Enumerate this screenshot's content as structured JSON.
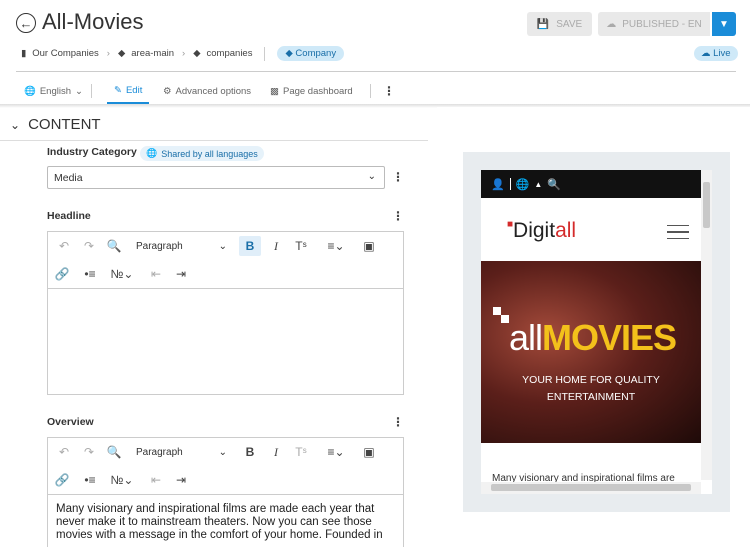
{
  "header": {
    "title": "All-Movies",
    "save_label": "SAVE",
    "publish_label": "PUBLISHED - EN",
    "breadcrumb": [
      "Our Companies",
      "area-main",
      "companies"
    ],
    "company_pill": "Company",
    "live_badge": "Live"
  },
  "tabs": {
    "language": "English",
    "edit": "Edit",
    "advanced": "Advanced options",
    "dashboard": "Page dashboard"
  },
  "content": {
    "section_title": "CONTENT",
    "industry_label": "Industry Category",
    "shared_badge": "Shared by all languages",
    "industry_value": "Media",
    "headline_label": "Headline",
    "overview_label": "Overview",
    "paragraph_style": "Paragraph",
    "overview_text": "Many visionary and inspirational films are made each year that never make it to mainstream theaters. Now you can see those movies with a message in the comfort of your home. Founded in"
  },
  "preview": {
    "logo_digit": "Digit",
    "logo_all": "all",
    "hero_all": "all",
    "hero_movies": "MOVIES",
    "hero_subtitle_1": "YOUR HOME FOR QUALITY",
    "hero_subtitle_2": "ENTERTAINMENT",
    "body_text": "Many visionary and inspirational films are"
  },
  "colors": {
    "accent": "#1a8cd8",
    "pill_bg": "#cfe9f8",
    "brand_red": "#d42b2b",
    "movies_yellow": "#f3c11b"
  }
}
